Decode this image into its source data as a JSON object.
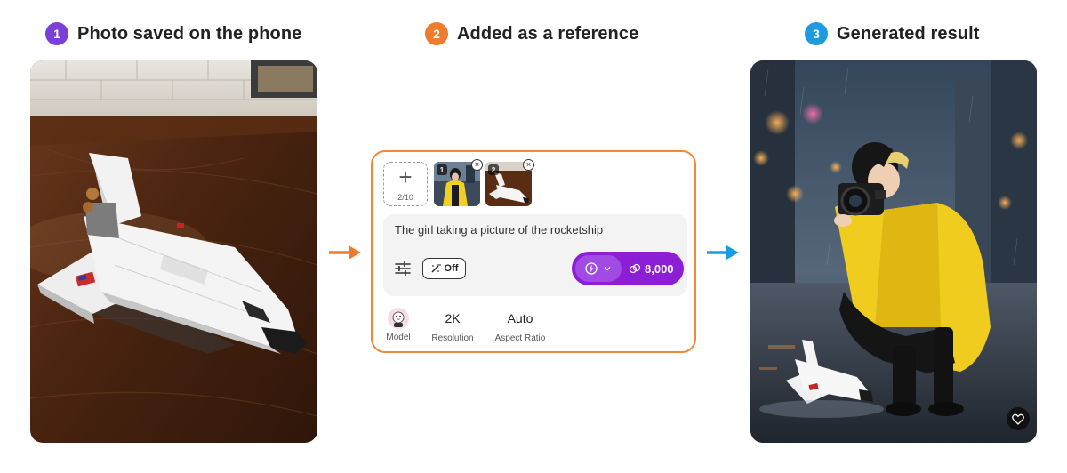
{
  "steps": [
    {
      "number": "1",
      "title": "Photo saved on the phone",
      "color": "#7b3fd9"
    },
    {
      "number": "2",
      "title": "Added as a reference",
      "color": "#ef7b2d"
    },
    {
      "number": "3",
      "title": "Generated result",
      "color": "#1d9be0"
    }
  ],
  "arrows": {
    "left_color": "#ef7b2d",
    "right_color": "#1d9be0"
  },
  "reference_panel": {
    "add_count": "2/10",
    "thumbnails": [
      {
        "index": "1",
        "subject": "girl in yellow raincoat"
      },
      {
        "index": "2",
        "subject": "space shuttle toy"
      }
    ],
    "prompt": "The girl taking a picture of the rocketship",
    "off_label": "Off",
    "credits": "8,000",
    "accent": "#8c1fd6",
    "options": {
      "model_label": "Model",
      "resolution_value": "2K",
      "resolution_label": "Resolution",
      "aspect_value": "Auto",
      "aspect_label": "Aspect Ratio"
    }
  },
  "icons": {
    "add": "plus-icon",
    "remove": "close-circle-icon",
    "settings": "sliders-icon",
    "magic": "magic-wand-icon",
    "model": "lightning-icon",
    "chevron": "chevron-down-icon",
    "credits": "coins-icon",
    "favorite": "heart-icon"
  }
}
